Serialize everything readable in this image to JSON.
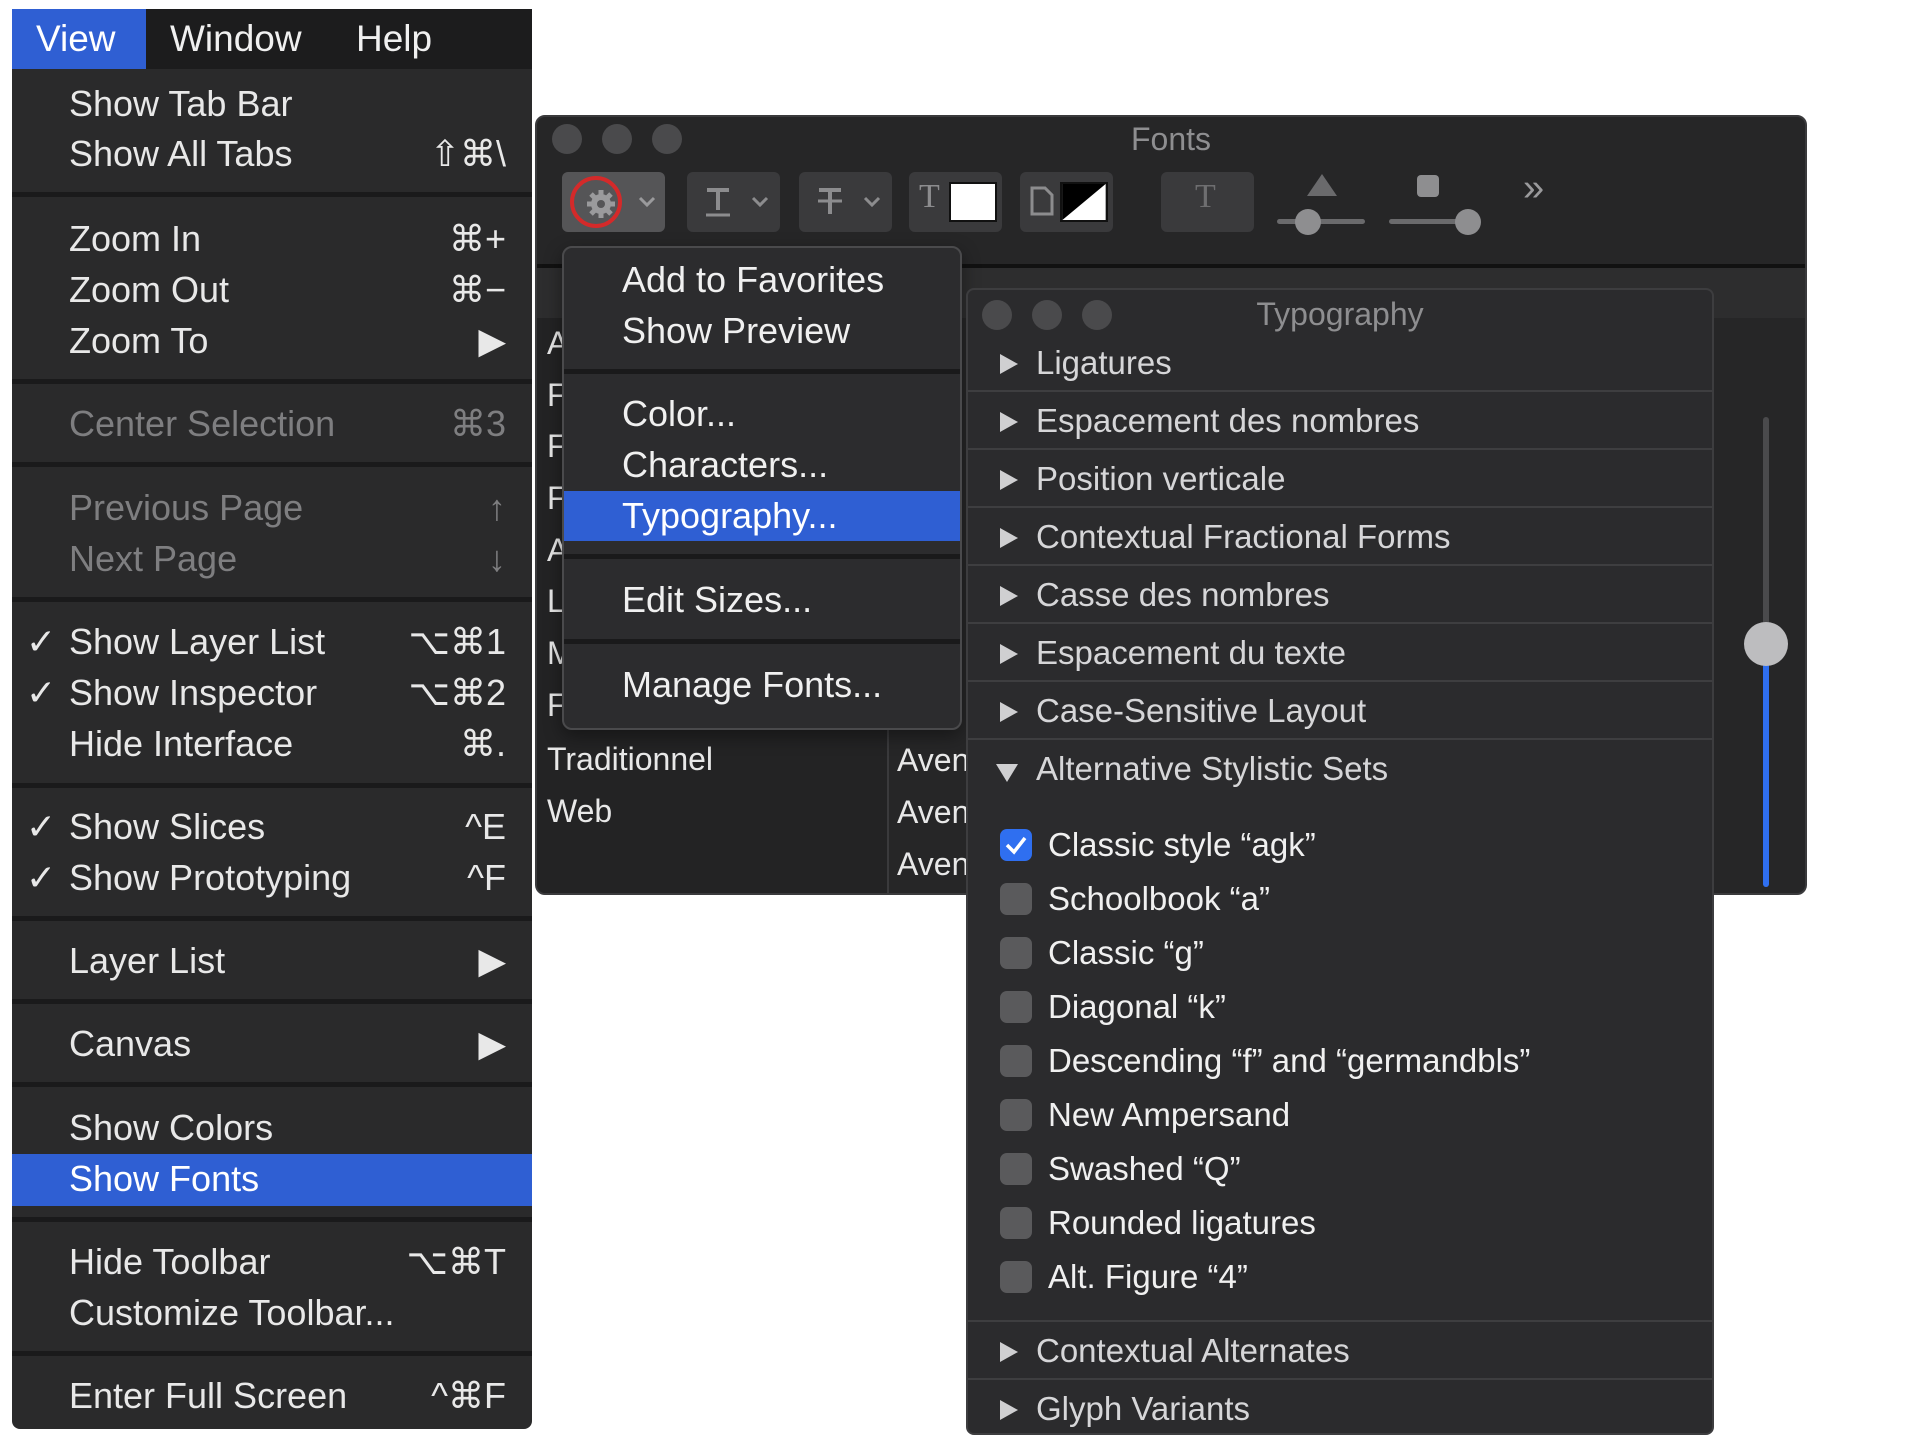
{
  "view_menu": {
    "menubar": [
      "View",
      "Window",
      "Help"
    ],
    "items": {
      "show_tab_bar": {
        "label": "Show Tab Bar"
      },
      "show_all_tabs": {
        "label": "Show All Tabs",
        "shortcut": "⇧⌘\\"
      },
      "zoom_in": {
        "label": "Zoom In",
        "shortcut": "⌘+"
      },
      "zoom_out": {
        "label": "Zoom Out",
        "shortcut": "⌘−"
      },
      "zoom_to": {
        "label": "Zoom To",
        "shortcut": "▶"
      },
      "center_selection": {
        "label": "Center Selection",
        "shortcut": "⌘3"
      },
      "previous_page": {
        "label": "Previous Page",
        "shortcut": "↑"
      },
      "next_page": {
        "label": "Next Page",
        "shortcut": "↓"
      },
      "show_layer_list": {
        "check": "✓",
        "label": "Show Layer List",
        "shortcut": "⌥⌘1"
      },
      "show_inspector": {
        "check": "✓",
        "label": "Show Inspector",
        "shortcut": "⌥⌘2"
      },
      "hide_interface": {
        "label": "Hide Interface",
        "shortcut": "⌘."
      },
      "show_slices": {
        "check": "✓",
        "label": "Show Slices",
        "shortcut": "^E"
      },
      "show_prototyping": {
        "check": "✓",
        "label": "Show Prototyping",
        "shortcut": "^F"
      },
      "layer_list": {
        "label": "Layer List",
        "shortcut": "▶"
      },
      "canvas": {
        "label": "Canvas",
        "shortcut": "▶"
      },
      "show_colors": {
        "label": "Show Colors"
      },
      "show_fonts": {
        "label": "Show Fonts"
      },
      "hide_toolbar": {
        "label": "Hide Toolbar",
        "shortcut": "⌥⌘T"
      },
      "customize_toolbar": {
        "label": "Customize Toolbar..."
      },
      "enter_full_screen": {
        "label": "Enter Full Screen",
        "shortcut": "^⌘F"
      }
    }
  },
  "fonts_window": {
    "title": "Fonts",
    "toolbar": {
      "text_glyph": "T",
      "overflow": "»"
    },
    "collections_partial": [
      "A",
      "F",
      "F",
      "F",
      "A",
      "L",
      "M",
      "F"
    ],
    "collections": [
      "Traditionnel",
      "Web"
    ],
    "family_partial": [
      "Aven",
      "Aven",
      "Aven"
    ]
  },
  "action_menu": {
    "items": [
      "Add to Favorites",
      "Show Preview",
      "Color...",
      "Characters...",
      "Typography...",
      "Edit Sizes...",
      "Manage Fonts..."
    ]
  },
  "typography": {
    "title": "Typography",
    "sections": [
      "Ligatures",
      "Espacement des nombres",
      "Position verticale",
      "Contextual Fractional Forms",
      "Casse des nombres",
      "Espacement du texte",
      "Case-Sensitive Layout",
      "Alternative Stylistic Sets"
    ],
    "stylistic_sets": [
      {
        "label": "Classic style “agk”",
        "checked": true
      },
      {
        "label": "Schoolbook “a”",
        "checked": false
      },
      {
        "label": "Classic “g”",
        "checked": false
      },
      {
        "label": "Diagonal “k”",
        "checked": false
      },
      {
        "label": "Descending “f” and “germandbls”",
        "checked": false
      },
      {
        "label": "New Ampersand",
        "checked": false
      },
      {
        "label": "Swashed “Q”",
        "checked": false
      },
      {
        "label": "Rounded ligatures",
        "checked": false
      },
      {
        "label": "Alt. Figure “4”",
        "checked": false
      }
    ],
    "bottom_sections": [
      "Contextual Alternates",
      "Glyph Variants"
    ]
  },
  "colors": {
    "accent": "#2f5fd3",
    "menu_bg": "#2a2a2b",
    "highlight_ring": "#d42a2a",
    "checkbox_on": "#2f6ff0"
  }
}
